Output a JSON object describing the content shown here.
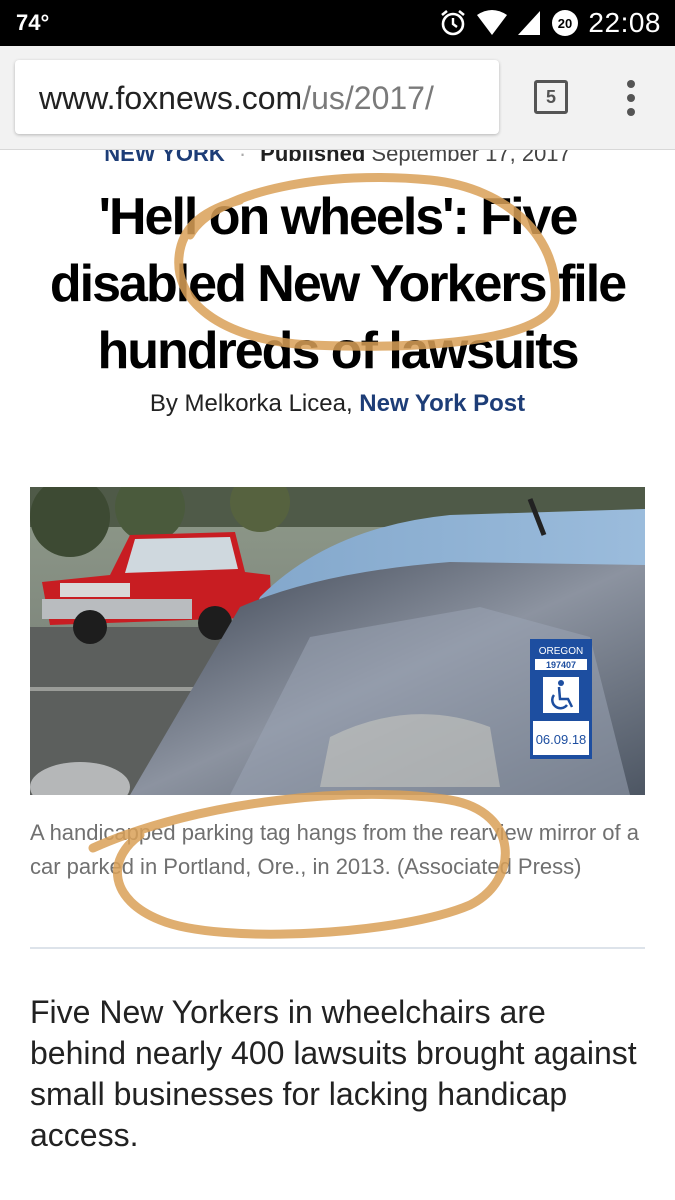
{
  "status_bar": {
    "temperature": "74°",
    "notification_count": "20",
    "time": "22:08"
  },
  "browser": {
    "url_host": "www.foxnews.com",
    "url_path": "/us/2017/",
    "tab_count": "5"
  },
  "article": {
    "section": "NEW YORK",
    "separator": "·",
    "published_label": "Published",
    "published_date": "September 17, 2017",
    "headline": "'Hell on wheels': Five disabled New Yorkers file hundreds of lawsuits",
    "byline_prefix": "By Melkorka Licea,",
    "byline_source": "New York Post",
    "photo": {
      "tag_state": "OREGON",
      "tag_number": "197407",
      "tag_expiry": "06.09.18"
    },
    "caption": "A handicapped parking tag hangs from the rearview mirror of a car parked in Portland, Ore., in 2013.  (Associated Press)",
    "body": "Five New Yorkers in wheelchairs are behind nearly 400 lawsuits brought against small businesses for lacking handicap access."
  },
  "colors": {
    "status_bar_bg": "#000000",
    "toolbar_bg": "#f2f2f2",
    "link_blue": "#1d3d77",
    "annotation_orange": "#d9a057"
  },
  "icons": [
    "alarm-icon",
    "wifi-icon",
    "cell-signal-icon",
    "notification-badge-icon",
    "tab-switcher-icon",
    "overflow-menu-icon",
    "accessibility-icon"
  ]
}
